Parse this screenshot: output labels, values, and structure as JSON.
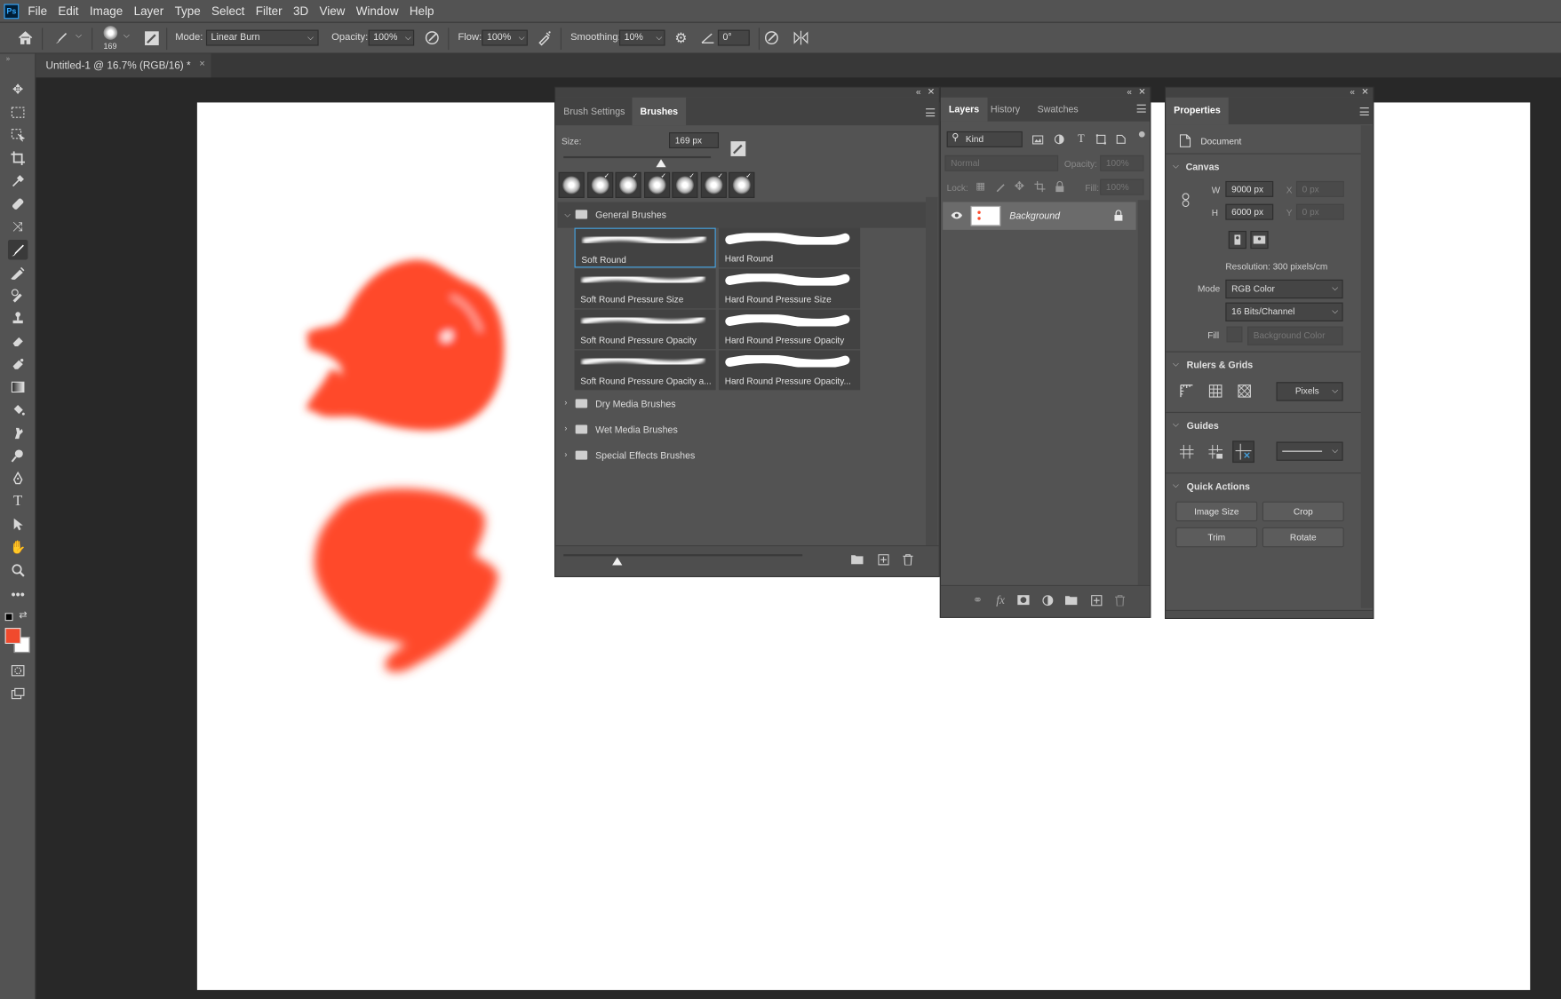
{
  "app": {
    "logo": "Ps",
    "menu": [
      "File",
      "Edit",
      "Image",
      "Layer",
      "Type",
      "Select",
      "Filter",
      "3D",
      "View",
      "Window",
      "Help"
    ]
  },
  "options": {
    "brush_size": "169",
    "mode_label": "Mode:",
    "mode_value": "Linear Burn",
    "opacity_label": "Opacity:",
    "opacity_value": "100%",
    "flow_label": "Flow:",
    "flow_value": "100%",
    "smoothing_label": "Smoothing:",
    "smoothing_value": "10%",
    "angle_value": "0°"
  },
  "document": {
    "tab_title": "Untitled-1 @ 16.7% (RGB/16) *",
    "close": "×"
  },
  "colors": {
    "foreground": "#f04a2d",
    "background": "#ffffff",
    "paint": "#ff4a2a",
    "selection": "#46a6e6"
  },
  "brushes_panel": {
    "tabs": [
      "Brush Settings",
      "Brushes"
    ],
    "size_label": "Size:",
    "size_value": "169 px",
    "groups": {
      "general": "General Brushes",
      "dry": "Dry Media Brushes",
      "wet": "Wet Media Brushes",
      "special": "Special Effects Brushes"
    },
    "brushes": [
      "Soft Round",
      "Hard Round",
      "Soft Round Pressure Size",
      "Hard Round Pressure Size",
      "Soft Round Pressure Opacity",
      "Hard Round Pressure Opacity",
      "Soft Round Pressure Opacity a...",
      "Hard Round Pressure Opacity..."
    ]
  },
  "layers_panel": {
    "tabs": [
      "Layers",
      "History",
      "Swatches"
    ],
    "kind_placeholder": "Kind",
    "blend_mode": "Normal",
    "opacity_label": "Opacity:",
    "opacity_value": "100%",
    "lock_label": "Lock:",
    "fill_label": "Fill:",
    "fill_value": "100%",
    "layer_name": "Background"
  },
  "properties_panel": {
    "title": "Properties",
    "doc_label": "Document",
    "canvas_title": "Canvas",
    "w_label": "W",
    "w_value": "9000 px",
    "h_label": "H",
    "h_value": "6000 px",
    "x_label": "X",
    "x_value": "0 px",
    "y_label": "Y",
    "y_value": "0 px",
    "resolution": "Resolution: 300 pixels/cm",
    "mode_label": "Mode",
    "mode_value": "RGB Color",
    "bits_value": "16 Bits/Channel",
    "fill_label": "Fill",
    "fill_value": "Background Color",
    "rulers_title": "Rulers & Grids",
    "units_value": "Pixels",
    "guides_title": "Guides",
    "quick_title": "Quick Actions",
    "btn_image_size": "Image Size",
    "btn_crop": "Crop",
    "btn_trim": "Trim",
    "btn_rotate": "Rotate"
  }
}
